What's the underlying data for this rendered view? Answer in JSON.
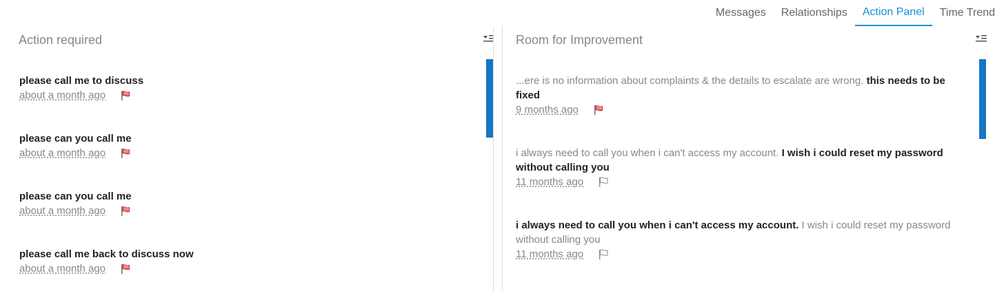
{
  "tabs": [
    {
      "label": "Messages",
      "active": false
    },
    {
      "label": "Relationships",
      "active": false
    },
    {
      "label": "Action Panel",
      "active": true
    },
    {
      "label": "Time Trend",
      "active": false
    }
  ],
  "left_panel": {
    "title": "Action required",
    "items": [
      {
        "text": "please call me to discuss",
        "time": "about a month ago",
        "flag": "red"
      },
      {
        "text": "please can you call me",
        "time": "about a month ago",
        "flag": "red"
      },
      {
        "text": "please can you call me",
        "time": "about a month ago",
        "flag": "red"
      },
      {
        "text": "please call me back to discuss now",
        "time": "about a month ago",
        "flag": "red"
      }
    ]
  },
  "right_panel": {
    "title": "Room for Improvement",
    "items": [
      {
        "light": "...ere is no information about complaints & the details to escalate are wrong. ",
        "strong": "this needs to be fixed",
        "time": "9 months ago",
        "flag": "red"
      },
      {
        "light": "i always need to call you when i can't access my account. ",
        "strong": "I wish i could reset my password without calling you",
        "time": "11 months ago",
        "flag": "outline"
      },
      {
        "strong": "i always need to call you when i can't access my account.",
        "light": " I wish i could reset my password without calling you",
        "time": "11 months ago",
        "flag": "outline"
      }
    ]
  },
  "colors": {
    "accent": "#1b8fd0",
    "scrollbar": "#1577c4",
    "flag_red": "#d9262c"
  }
}
